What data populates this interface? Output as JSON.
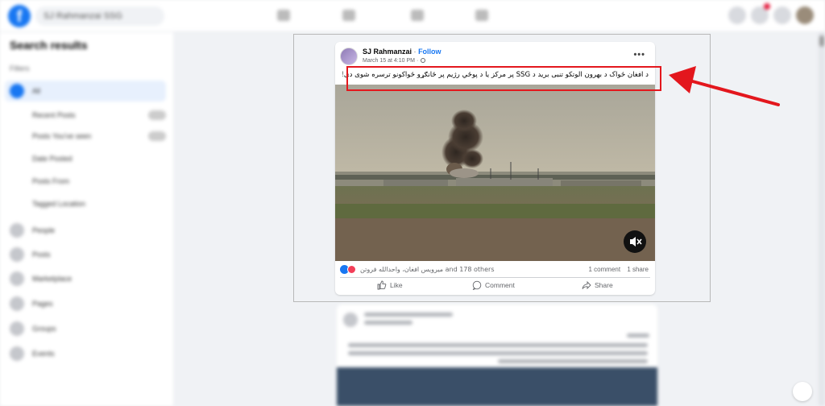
{
  "topbar": {
    "logo": "f",
    "search_value": "SJ Rahmanzai SSG"
  },
  "sidebar": {
    "title": "Search results",
    "filter_label": "Filters",
    "all_label": "All",
    "options": [
      "Recent Posts",
      "Posts You've seen",
      "Date Posted",
      "Posts From",
      "Tagged Location"
    ],
    "categories": [
      "People",
      "Posts",
      "Marketplace",
      "Pages",
      "Groups",
      "Events"
    ]
  },
  "post": {
    "author": "SJ Rahmanzai",
    "separator": "·",
    "follow_label": "Follow",
    "timestamp": "March 15 at 4:10 PM",
    "time_separator": "·",
    "more_label": "•••",
    "caption": "د افغان ځواک د بهرون الوتکو تنبی برید د SSG پر مرکز یا د پوځي رژیم پر ځانګړو ځواکونو ترسره شوی دی!",
    "reactions_text": "میرویس افغان، واحدالله فروتن and 178 others",
    "comments": "1 comment",
    "shares": "1 share",
    "like_label": "Like",
    "comment_label": "Comment",
    "share_label": "Share"
  },
  "colors": {
    "facebook_blue": "#1877f2",
    "annotation_red": "#e3171d",
    "love_red": "#f33e58"
  },
  "icons": {
    "mute": "speaker-muted-icon",
    "like": "thumbs-up-icon",
    "comment": "speech-bubble-icon",
    "share": "share-arrow-icon"
  }
}
